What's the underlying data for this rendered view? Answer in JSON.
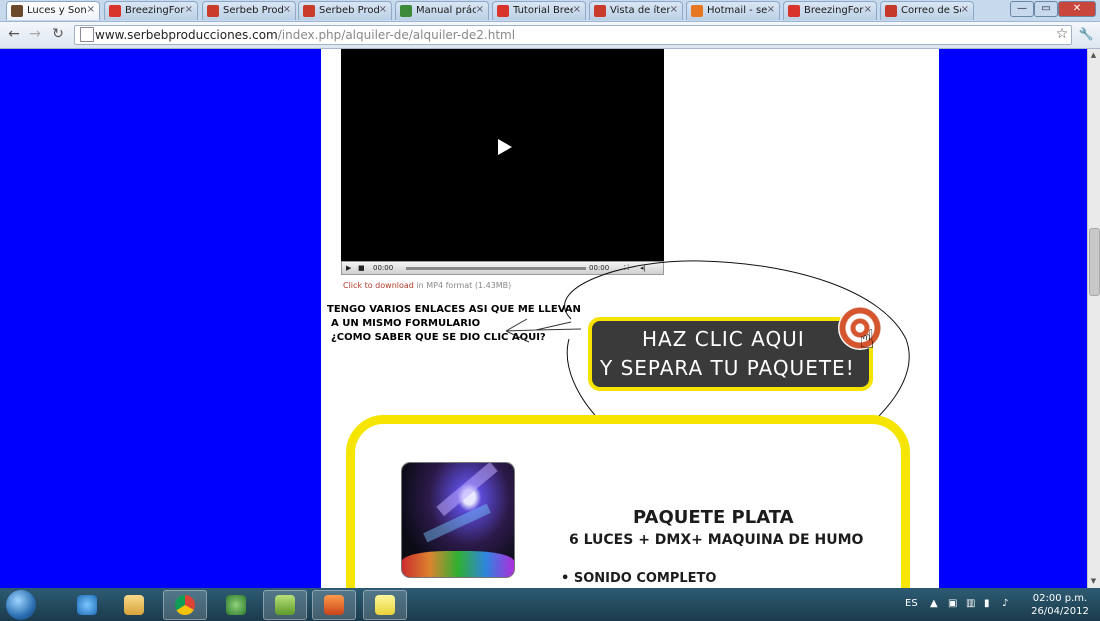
{
  "browser": {
    "tabs": [
      {
        "label": "Luces y Sonid",
        "favicon_color": "#6a4a2a",
        "active": true
      },
      {
        "label": "BreezingForm",
        "favicon_color": "#d9342b",
        "active": false
      },
      {
        "label": "Serbeb Produ",
        "favicon_color": "#c93c2c",
        "active": false
      },
      {
        "label": "Serbeb Produ",
        "favicon_color": "#c93c2c",
        "active": false
      },
      {
        "label": "Manual prácti",
        "favicon_color": "#3a8a3a",
        "active": false
      },
      {
        "label": "Tutorial Bree",
        "favicon_color": "#d9342b",
        "active": false
      },
      {
        "label": "Vista de ítem",
        "favicon_color": "#c93c2c",
        "active": false
      },
      {
        "label": "Hotmail - ser",
        "favicon_color": "#e87722",
        "active": false
      },
      {
        "label": "BreezingForm",
        "favicon_color": "#d9342b",
        "active": false
      },
      {
        "label": "Correo de Ser",
        "favicon_color": "#c5392a",
        "active": false
      }
    ],
    "tab_close": "×",
    "window_controls": {
      "minimize": "—",
      "maximize": "▭",
      "close": "✕"
    },
    "back_icon": "←",
    "forward_icon": "→",
    "reload_icon": "↻",
    "address": {
      "host": "www.serbebproducciones.com",
      "path": "/index.php/alquiler-de/alquiler-de2.html"
    },
    "star_icon": "☆",
    "wrench_icon": "🔧"
  },
  "page": {
    "video_controls": {
      "play": "▶",
      "stop": "■",
      "time_current": "00:00",
      "time_total": "00:00",
      "fullscreen": "⛶",
      "volume": "◂|"
    },
    "download": {
      "link": "Click to download",
      "rest": " in MP4 format (1.43MB)"
    },
    "note_lines": [
      "TENGO VARIOS ENLACES ASI QUE ME LLEVAN",
      "A UN MISMO FORMULARIO",
      "¿COMO SABER QUE SE DIO CLIC AQUI?"
    ],
    "cta": {
      "line1": "HAZ CLIC AQUI",
      "line2": "Y SEPARA TU PAQUETE!"
    },
    "package": {
      "title": "PAQUETE PLATA",
      "subtitle": "6 LUCES + DMX+ MAQUINA DE HUMO",
      "items": [
        "• SONIDO COMPLETO"
      ]
    }
  },
  "taskbar": {
    "lang": "ES",
    "time": "02:00 p.m.",
    "date": "26/04/2012",
    "tray_icons": [
      "▲",
      "▣",
      "▥",
      "▮",
      "♪"
    ]
  }
}
